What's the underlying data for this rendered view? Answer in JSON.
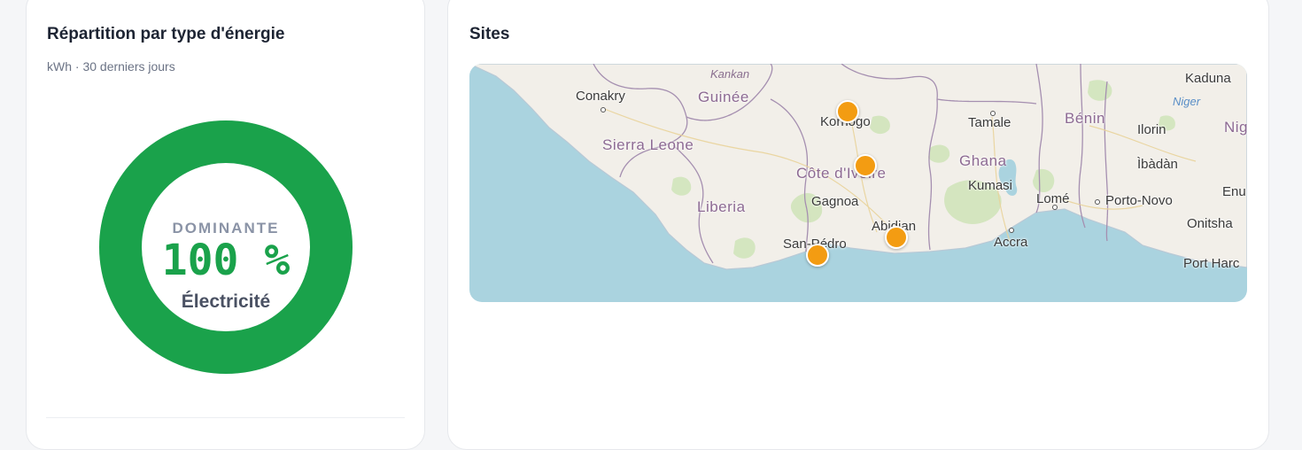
{
  "energy_card": {
    "title": "Répartition par type d'énergie",
    "subtitle": "kWh · 30 derniers jours",
    "donut": {
      "label": "DOMINANTE",
      "value": "100 %",
      "type": "Électricité",
      "share": 1.0,
      "color": "#1aa24b"
    }
  },
  "sites_card": {
    "title": "Sites",
    "map": {
      "water_color": "#aad3df",
      "land_color": "#f2efe9",
      "marker_color": "#f39c12",
      "countries": [
        "Guinée",
        "Sierra Leone",
        "Liberia",
        "Côte d'Ivoire",
        "Ghana",
        "Bénin",
        "Nig"
      ],
      "cities": [
        "Conakry",
        "Korhogo",
        "Tamale",
        "Gagnoa",
        "Kumasi",
        "Lomé",
        "Porto-Novo",
        "Abidjan",
        "San-Pédro",
        "Accra",
        "Kaduna",
        "Ilorin",
        "Ìbàdàn",
        "Enu",
        "Onitsha",
        "Port Harc"
      ],
      "regions": [
        "Kankan",
        "Niger"
      ],
      "markers": [
        {
          "name": "Korhogo"
        },
        {
          "name": "Côte d'Ivoire"
        },
        {
          "name": "Abidjan"
        },
        {
          "name": "San-Pédro"
        }
      ]
    }
  }
}
